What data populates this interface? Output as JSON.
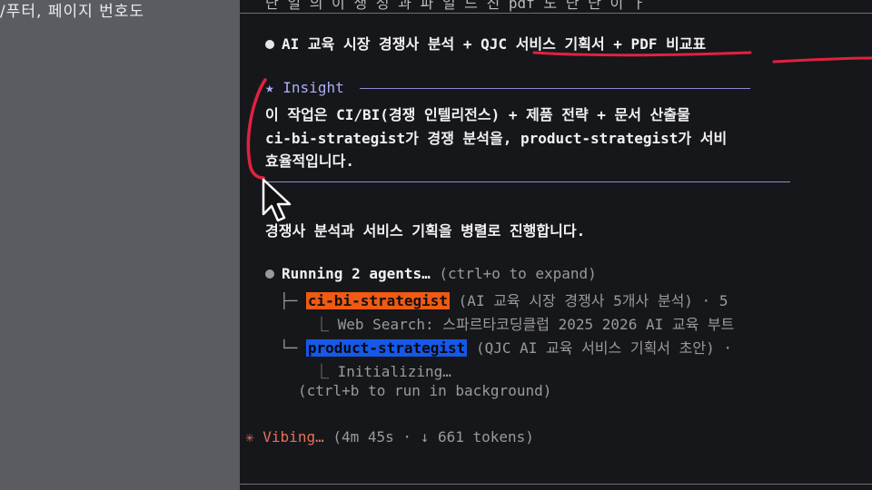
{
  "left_panel": {
    "text": "/푸터, 페이지 번호도"
  },
  "terminal": {
    "cut_line": "단 일 의 이 생 성 과 파 일 드 진 pdf 도 단 단 이 ㅏ",
    "task_line": "AI 교육 시장 경쟁사 분석 + QJC 서비스 기획서 + PDF 비교표",
    "insight": {
      "icon": "★",
      "label": "Insight",
      "lines": [
        "이 작업은 CI/BI(경쟁 인텔리전스) + 제품 전략 + 문서 산출물",
        "ci-bi-strategist가 경쟁 분석을, product-strategist가 서비",
        "효율적입니다."
      ]
    },
    "plan_line": "경쟁사 분석과 서비스 기획을 병렬로 진행합니다.",
    "running": {
      "title": "Running 2 agents…",
      "hint": "(ctrl+o to expand)"
    },
    "agents": [
      {
        "name": "ci-bi-strategist",
        "desc": "(AI 교육 시장 경쟁사 5개사 분석) · 5",
        "sub": "Web Search: 스파르타코딩클럽 2025 2026 AI 교육 부트",
        "color": "#f05a12"
      },
      {
        "name": "product-strategist",
        "desc": "(QJC AI 교육 서비스 기획서 초안) ·",
        "sub": "Initializing…",
        "color": "#1658e8"
      }
    ],
    "background_hint": "(ctrl+b to run in background)",
    "status": {
      "icon": "✳",
      "label": "Vibing…",
      "detail": "(4m 45s · ↓ 661 tokens)"
    }
  }
}
